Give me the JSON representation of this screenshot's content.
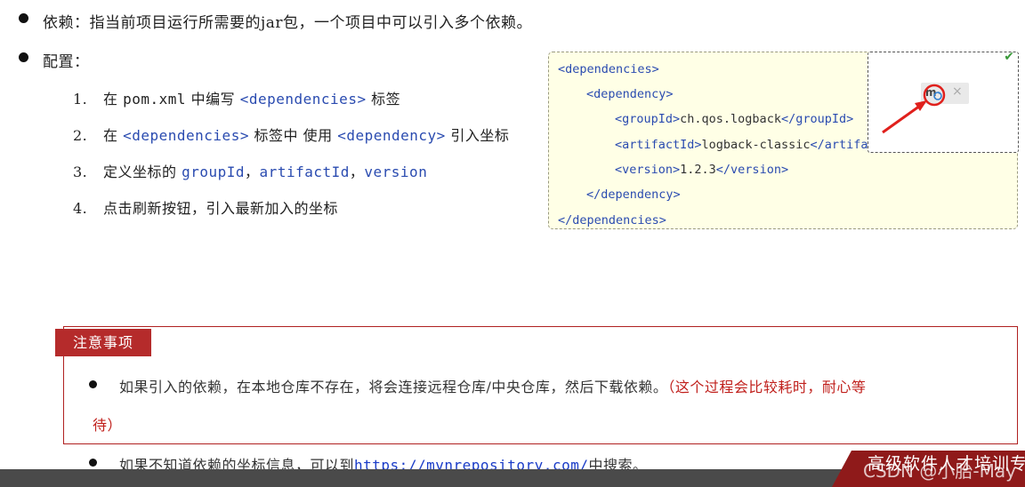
{
  "bullets": {
    "dependency": {
      "label": "依赖：",
      "text": "指当前项目运行所需要的jar包，一个项目中可以引入多个依赖。"
    },
    "config": {
      "label": "配置："
    }
  },
  "steps": [
    {
      "num": "1.",
      "pre": "在 ",
      "code": "pom.xml",
      "mid": " 中编写 ",
      "tag": "<dependencies>",
      "post": " 标签"
    },
    {
      "num": "2.",
      "pre": "在 ",
      "tag": "<dependencies>",
      "mid": " 标签中 使用 ",
      "tag2": "<dependency>",
      "post": " 引入坐标"
    },
    {
      "num": "3.",
      "pre": "定义坐标的 ",
      "a": "groupId",
      "sep1": "，",
      "b": "artifactId",
      "sep2": "，",
      "c": "version"
    },
    {
      "num": "4.",
      "text": "点击刷新按钮，引入最新加入的坐标"
    }
  ],
  "code": {
    "l1": "<dependencies>",
    "l2": "<dependency>",
    "l3_open": "<groupId>",
    "l3_val": "ch.qos.logback",
    "l3_close": "</groupId>",
    "l4_open": "<artifactId>",
    "l4_val": "logback-classic",
    "l4_close": "</artifac",
    "l5_open": "<version>",
    "l5_val": "1.2.3",
    "l5_close": "</version>",
    "l6": "</dependency>",
    "l7": "</dependencies>"
  },
  "refresh_overlay": {
    "close_glyph": "×",
    "check_glyph": "✔"
  },
  "note": {
    "title": "注意事项",
    "item1": "如果引入的依赖，在本地仓库不存在，将会连接远程仓库/中央仓库，然后下载依赖。",
    "item1_red": "（这个过程会比较耗时，耐心等",
    "item1_red_cont": "待）",
    "item2_pre": "如果不知道依赖的坐标信息，可以到",
    "item2_link": "https://mvnrepository.com/",
    "item2_post": "中搜索。"
  },
  "footer": {
    "banner": "高级软件人才培训专",
    "watermark": "CSDN @小胎-May"
  },
  "colors": {
    "accent_red": "#b52b2b",
    "code_bg": "#ffffe6",
    "tag_blue": "#2a4bb0",
    "link_blue": "#1a3cc8"
  }
}
